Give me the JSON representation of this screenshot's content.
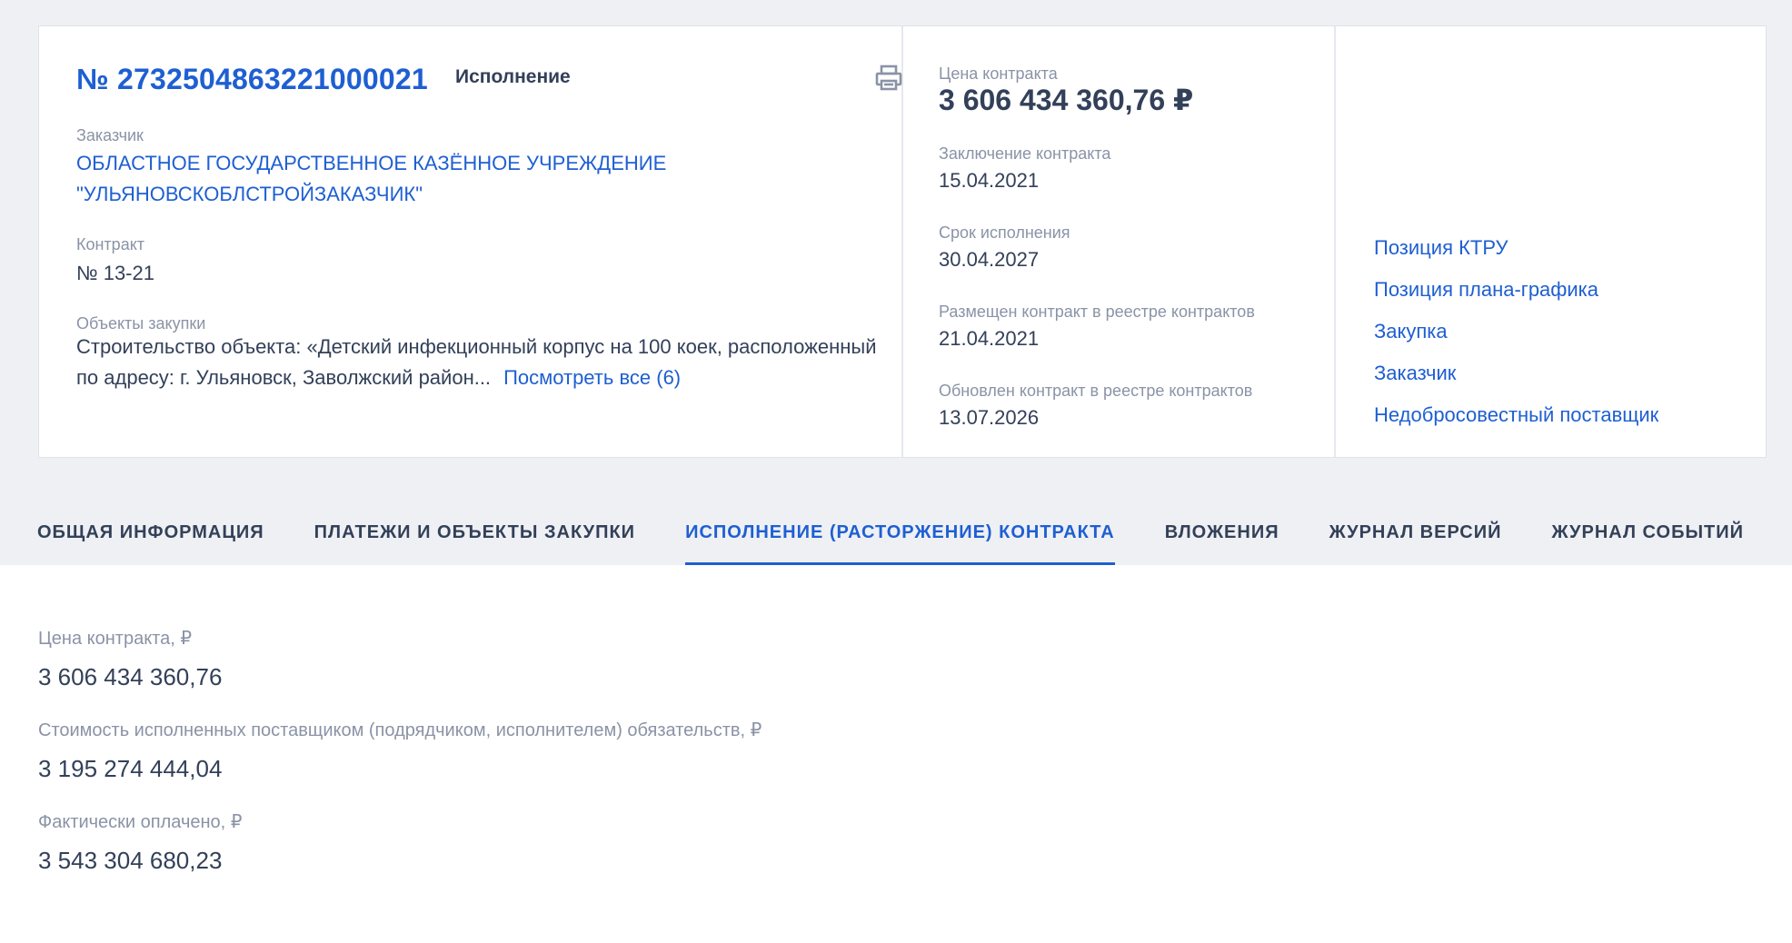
{
  "header": {
    "reg_number": "№ 2732504863221000021",
    "status": "Исполнение",
    "customer_label": "Заказчик",
    "customer_name": "ОБЛАСТНОЕ ГОСУДАРСТВЕННОЕ КАЗЁННОЕ УЧРЕЖДЕНИЕ \"УЛЬЯНОВСКОБЛСТРОЙЗАКАЗЧИК\"",
    "contract_label": "Контракт",
    "contract_number": "№ 13-21",
    "objects_label": "Объекты закупки",
    "objects_text": "Строительство объекта: «Детский инфекционный корпус на 100 коек, расположенный по адресу: г. Ульяновск, Заволжский район...",
    "objects_see_all": "Посмотреть все (6)",
    "print_icon": "print-icon"
  },
  "summary": {
    "price_label": "Цена контракта",
    "price_value": "3 606 434 360,76 ₽",
    "conclusion_label": "Заключение контракта",
    "conclusion_value": "15.04.2021",
    "term_label": "Срок исполнения",
    "term_value": "30.04.2027",
    "placed_label": "Размещен контракт в реестре контрактов",
    "placed_value": "21.04.2021",
    "updated_label": "Обновлен контракт в реестре контрактов",
    "updated_value": "13.07.2026"
  },
  "side_links": [
    "Позиция КТРУ",
    "Позиция плана-графика",
    "Закупка",
    "Заказчик",
    "Недобросовестный поставщик"
  ],
  "tabs": [
    {
      "label": "ОБЩАЯ ИНФОРМАЦИЯ",
      "active": false
    },
    {
      "label": "ПЛАТЕЖИ И ОБЪЕКТЫ ЗАКУПКИ",
      "active": false
    },
    {
      "label": "ИСПОЛНЕНИЕ (РАСТОРЖЕНИЕ) КОНТРАКТА",
      "active": true
    },
    {
      "label": "ВЛОЖЕНИЯ",
      "active": false
    },
    {
      "label": "ЖУРНАЛ ВЕРСИЙ",
      "active": false
    },
    {
      "label": "ЖУРНАЛ СОБЫТИЙ",
      "active": false
    }
  ],
  "execution": {
    "items": [
      {
        "label": "Цена контракта, ₽",
        "value": "3 606 434 360,76"
      },
      {
        "label": "Стоимость исполненных поставщиком (подрядчиком, исполнителем) обязательств, ₽",
        "value": "3 195 274 444,04"
      },
      {
        "label": "Фактически оплачено, ₽",
        "value": "3 543 304 680,23"
      }
    ]
  },
  "colors": {
    "accent": "#1e5fd2",
    "text": "#334059",
    "muted": "#8a93a6",
    "background": "#eef0f3"
  }
}
